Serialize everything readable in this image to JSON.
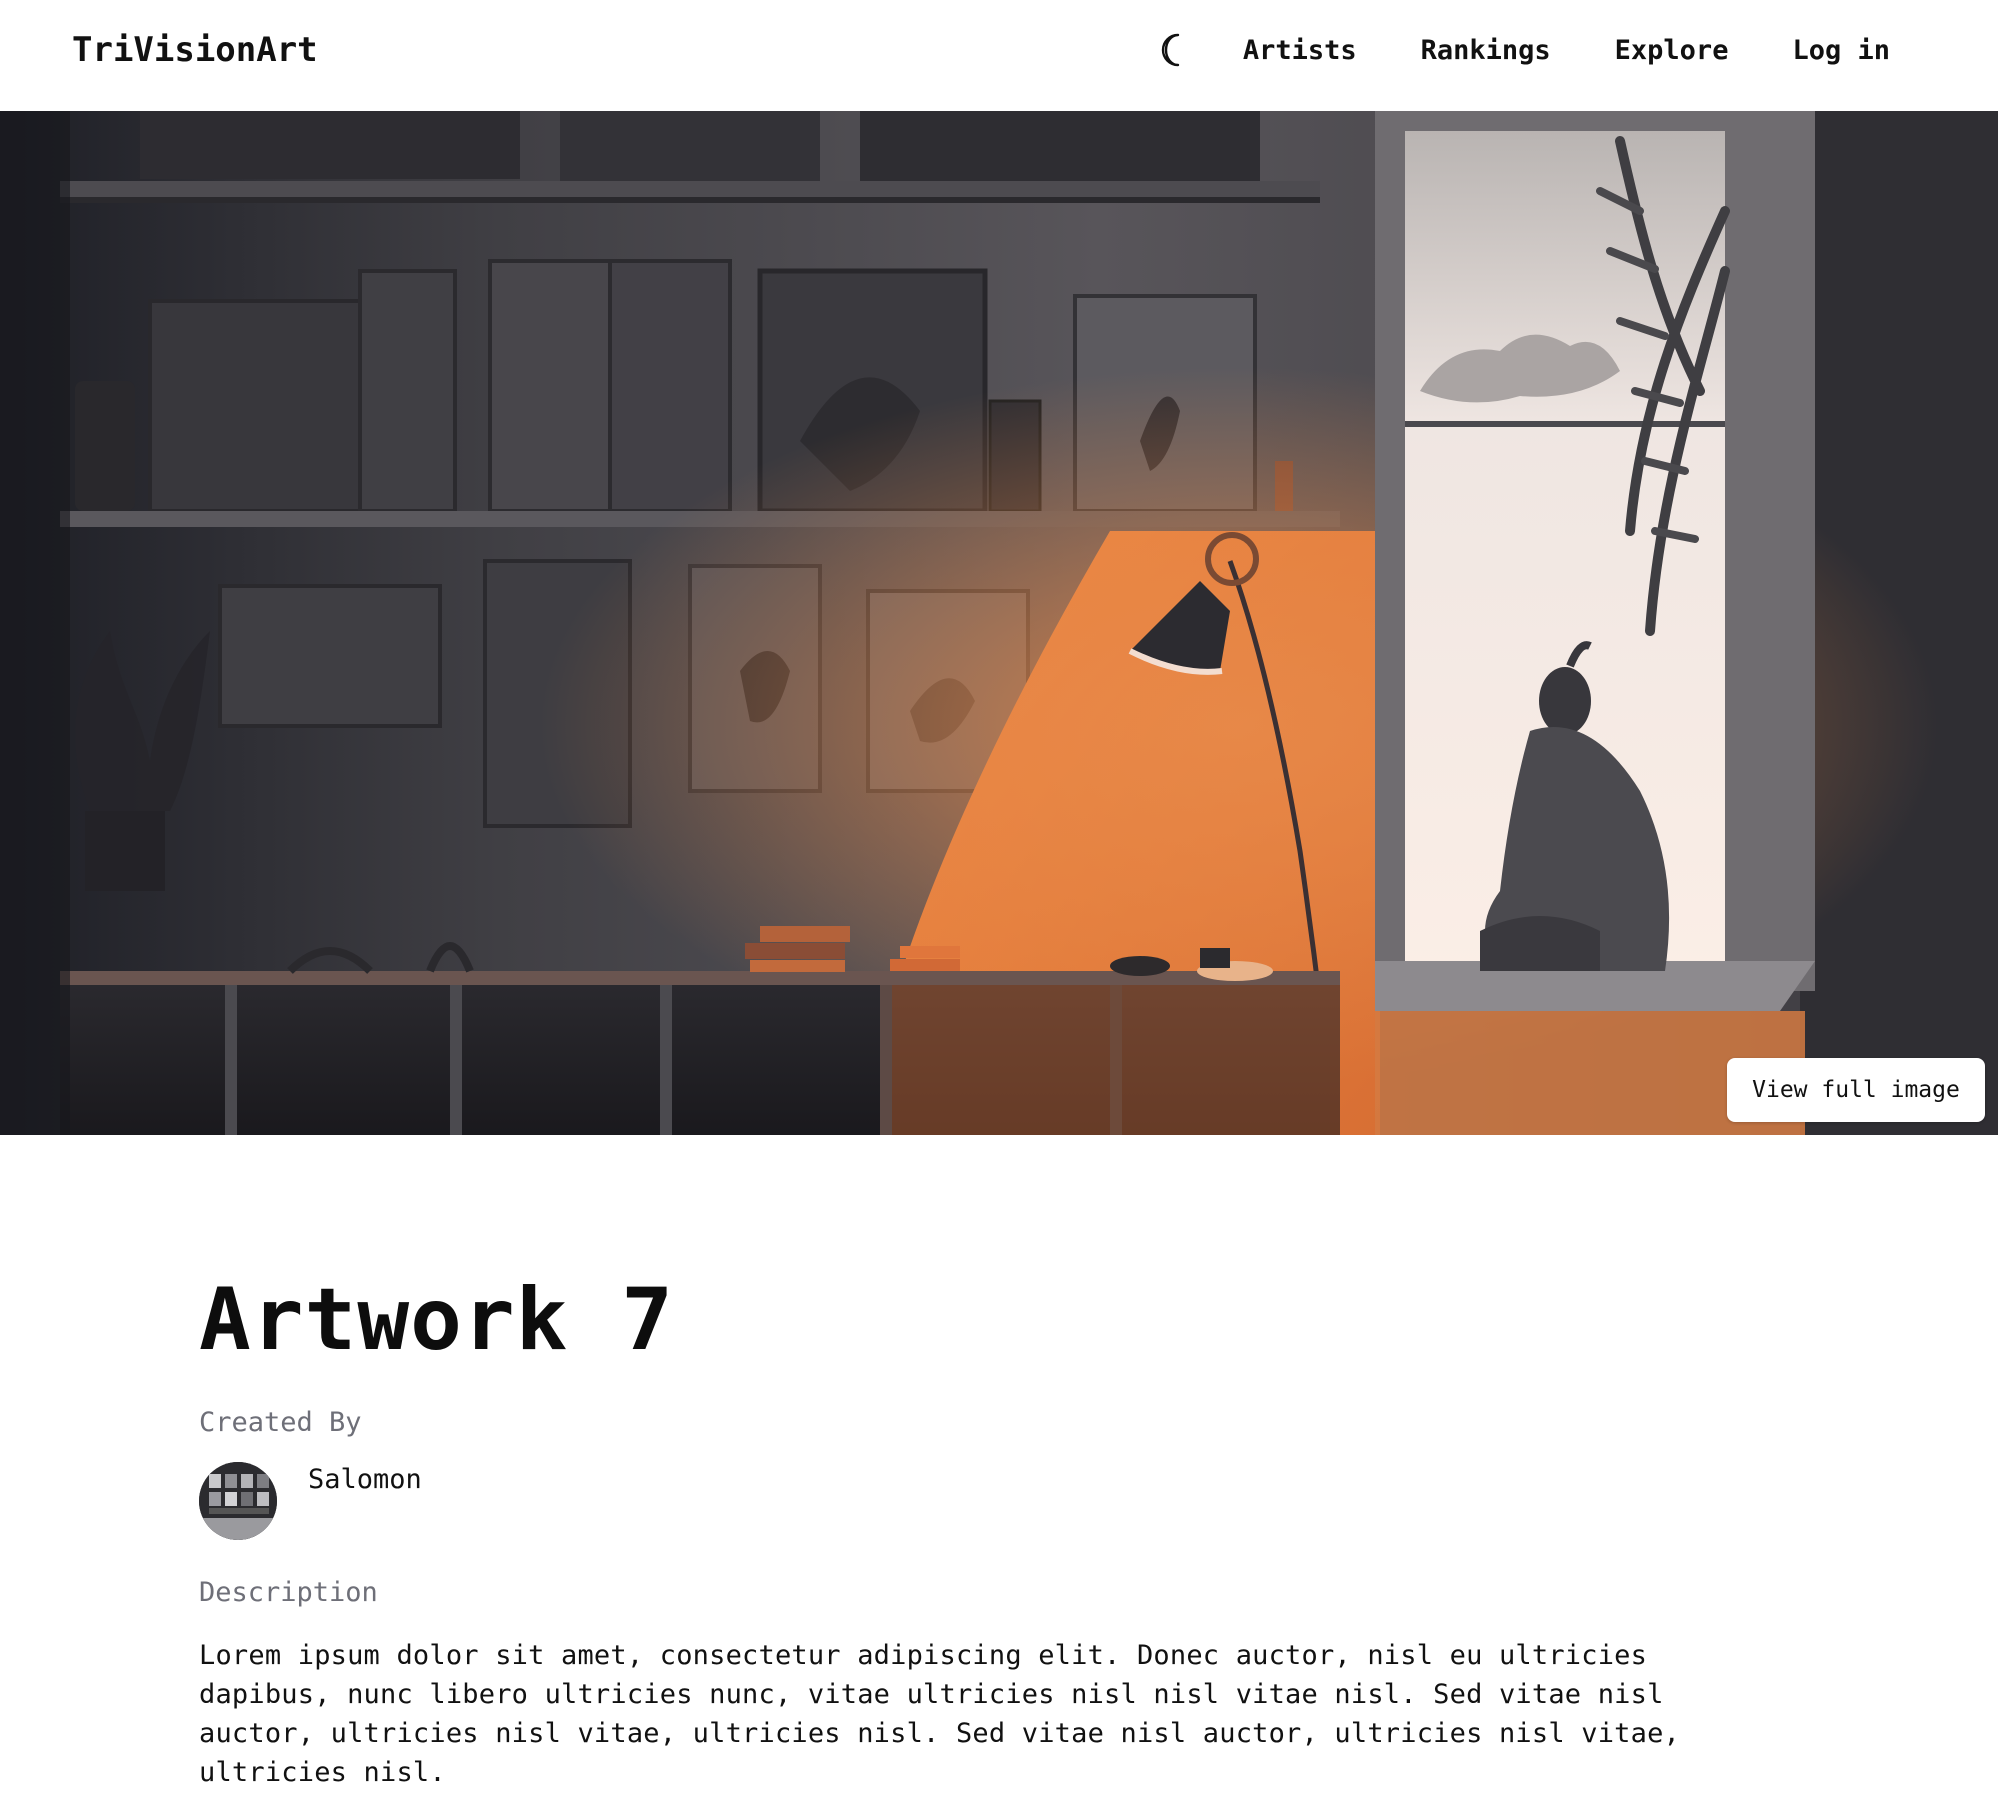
{
  "header": {
    "brand": "TriVisionArt",
    "theme_toggle_icon": "moon-icon",
    "nav": [
      {
        "label": "Artists"
      },
      {
        "label": "Rankings"
      },
      {
        "label": "Explore"
      },
      {
        "label": "Log in"
      }
    ]
  },
  "hero": {
    "image_icon": "artwork-image",
    "view_full_label": "View full image"
  },
  "artwork": {
    "title": "Artwork 7",
    "created_by_label": "Created By",
    "creator": {
      "name": "Salomon",
      "avatar_icon": "avatar-image"
    },
    "description_label": "Description",
    "description": "Lorem ipsum dolor sit amet, consectetur adipiscing elit. Donec auctor, nisl eu ultricies dapibus, nunc libero ultricies nunc, vitae ultricies nisl nisl vitae nisl. Sed vitae nisl auctor, ultricies nisl vitae, ultricies nisl. Sed vitae nisl auctor, ultricies nisl vitae, ultricies nisl."
  },
  "colors": {
    "background": "#ffffff",
    "text": "#111111",
    "muted": "#6e6f78",
    "lamp_glow": "#e07a3c"
  }
}
